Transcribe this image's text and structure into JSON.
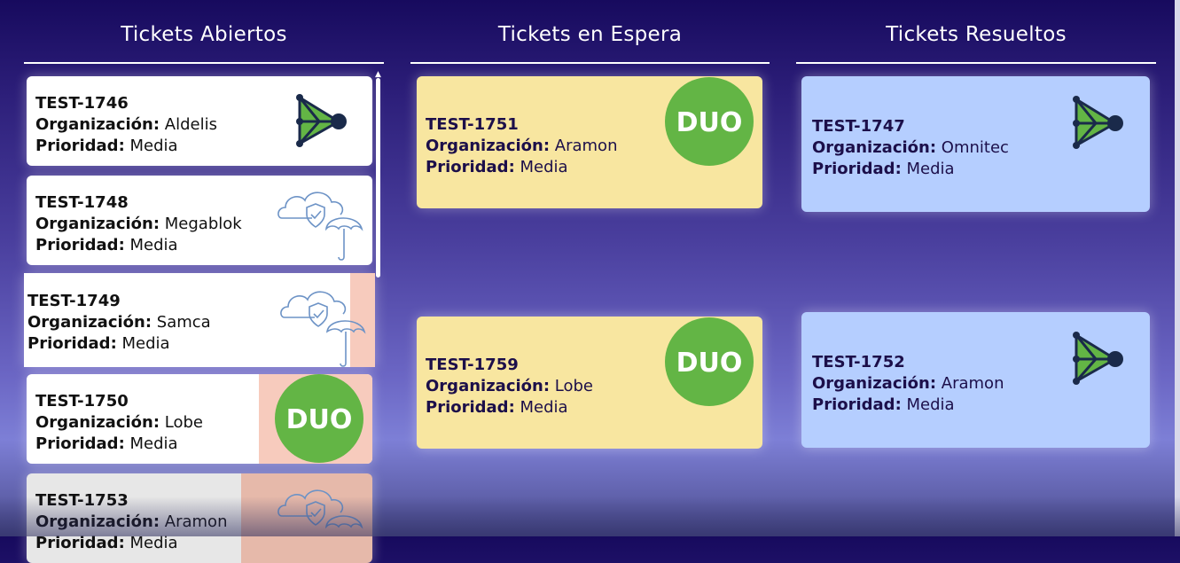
{
  "columns": {
    "open": {
      "title": "Tickets Abiertos"
    },
    "waiting": {
      "title": "Tickets en Espera"
    },
    "resolved": {
      "title": "Tickets Resueltos"
    }
  },
  "labels": {
    "org": "Organización:",
    "priority": "Prioridad:"
  },
  "open_tickets": [
    {
      "id": "TEST-1746",
      "org": "Aldelis",
      "priority": "Media",
      "icon": "network-play-icon"
    },
    {
      "id": "TEST-1748",
      "org": "Megablok",
      "priority": "Media",
      "icon": "cloud-shield-umbrella-icon"
    },
    {
      "id": "TEST-1749",
      "org": "Samca",
      "priority": "Media",
      "icon": "cloud-shield-umbrella-icon"
    },
    {
      "id": "TEST-1750",
      "org": "Lobe",
      "priority": "Media",
      "icon": "duo-logo"
    },
    {
      "id": "TEST-1753",
      "org": "Aramon",
      "priority": "Media",
      "icon": "cloud-shield-umbrella-icon"
    }
  ],
  "waiting_tickets": [
    {
      "id": "TEST-1751",
      "org": "Aramon",
      "priority": "Media",
      "icon": "duo-logo"
    },
    {
      "id": "TEST-1759",
      "org": "Lobe",
      "priority": "Media",
      "icon": "duo-logo"
    }
  ],
  "resolved_tickets": [
    {
      "id": "TEST-1747",
      "org": "Omnitec",
      "priority": "Media",
      "icon": "network-play-icon"
    },
    {
      "id": "TEST-1752",
      "org": "Aramon",
      "priority": "Media",
      "icon": "network-play-icon"
    }
  ],
  "duo_text": "DUO",
  "colors": {
    "white_card": "#ffffff",
    "yellow_card": "#f8e6a0",
    "blue_card": "#b5ceff",
    "salmon": "#f7cbbd",
    "duo_green": "#63b545"
  }
}
